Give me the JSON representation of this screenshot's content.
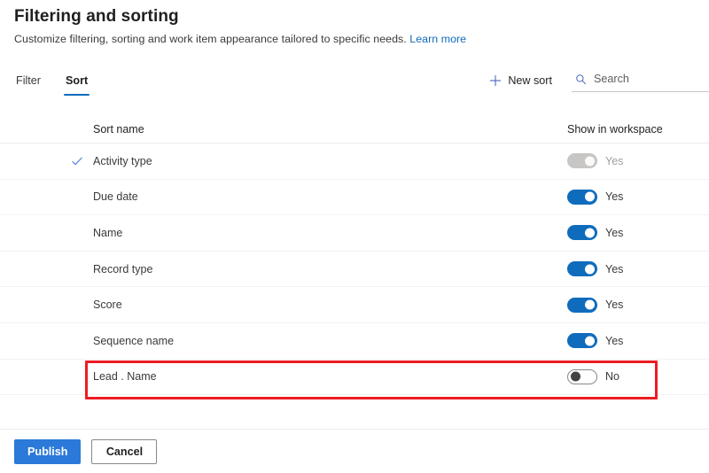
{
  "header": {
    "title": "Filtering and sorting",
    "subtitle": "Customize filtering, sorting and work item appearance tailored to specific needs.",
    "learn_more": "Learn more"
  },
  "tabs": [
    {
      "label": "Filter",
      "active": false
    },
    {
      "label": "Sort",
      "active": true
    }
  ],
  "commands": {
    "new_sort_label": "New sort",
    "new_sort_icon": "plus-icon",
    "search_placeholder": "Search",
    "search_value": "",
    "search_icon": "search-icon"
  },
  "table": {
    "columns": {
      "sort_name": "Sort name",
      "show_in_workspace": "Show in workspace"
    },
    "rows": [
      {
        "name": "Activity type",
        "checked": true,
        "toggle_state": "disabled-on",
        "toggle_label": "Yes"
      },
      {
        "name": "Due date",
        "checked": false,
        "toggle_state": "on",
        "toggle_label": "Yes"
      },
      {
        "name": "Name",
        "checked": false,
        "toggle_state": "on",
        "toggle_label": "Yes"
      },
      {
        "name": "Record type",
        "checked": false,
        "toggle_state": "on",
        "toggle_label": "Yes"
      },
      {
        "name": "Score",
        "checked": false,
        "toggle_state": "on",
        "toggle_label": "Yes"
      },
      {
        "name": "Sequence name",
        "checked": false,
        "toggle_state": "on",
        "toggle_label": "Yes"
      },
      {
        "name": "Lead . Name",
        "checked": false,
        "toggle_state": "off",
        "toggle_label": "No",
        "highlighted": true
      }
    ]
  },
  "footer": {
    "publish_label": "Publish",
    "cancel_label": "Cancel"
  },
  "colors": {
    "accent": "#0f6cbd",
    "primary_button": "#2b79d8",
    "link": "#0f6cbd",
    "highlight_outline": "#ed1c24",
    "toggle_on": "#0f6cbd",
    "toggle_disabled": "#c8c6c4"
  }
}
